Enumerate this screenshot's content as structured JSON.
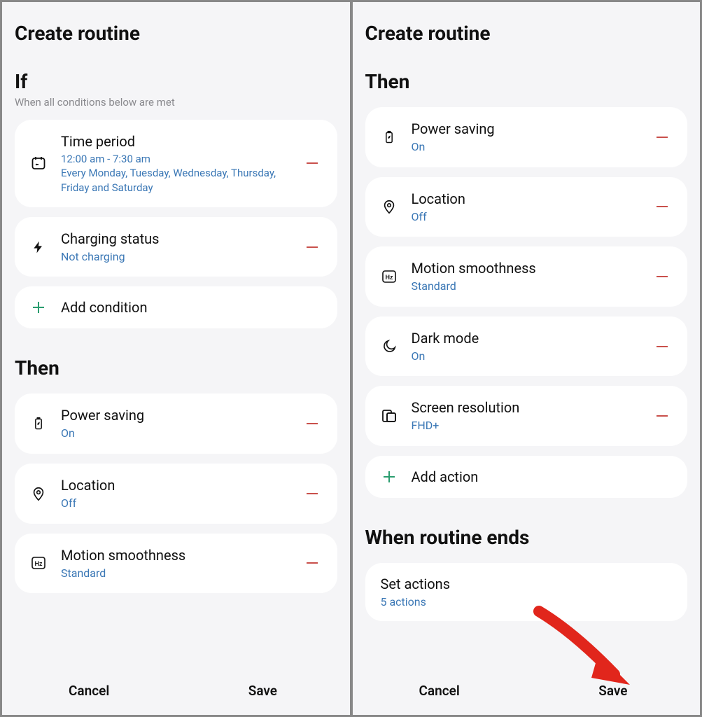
{
  "left": {
    "title": "Create routine",
    "if": {
      "heading": "If",
      "subtitle": "When all conditions below are met",
      "items": [
        {
          "label": "Time period",
          "value": "12:00  am - 7:30  am\nEvery Monday, Tuesday, Wednesday, Thursday, Friday and Saturday"
        },
        {
          "label": "Charging status",
          "value": "Not charging"
        }
      ],
      "add": "Add condition"
    },
    "then": {
      "heading": "Then",
      "items": [
        {
          "label": "Power saving",
          "value": "On"
        },
        {
          "label": "Location",
          "value": "Off"
        },
        {
          "label": "Motion smoothness",
          "value": "Standard"
        }
      ]
    },
    "footer": {
      "cancel": "Cancel",
      "save": "Save"
    }
  },
  "right": {
    "title": "Create routine",
    "then": {
      "heading": "Then",
      "items": [
        {
          "label": "Power saving",
          "value": "On"
        },
        {
          "label": "Location",
          "value": "Off"
        },
        {
          "label": "Motion smoothness",
          "value": "Standard"
        },
        {
          "label": "Dark mode",
          "value": "On"
        },
        {
          "label": "Screen resolution",
          "value": "FHD+"
        }
      ],
      "add": "Add action"
    },
    "ends": {
      "heading": "When routine ends",
      "set_actions_label": "Set actions",
      "set_actions_value": "5 actions"
    },
    "footer": {
      "cancel": "Cancel",
      "save": "Save"
    }
  }
}
